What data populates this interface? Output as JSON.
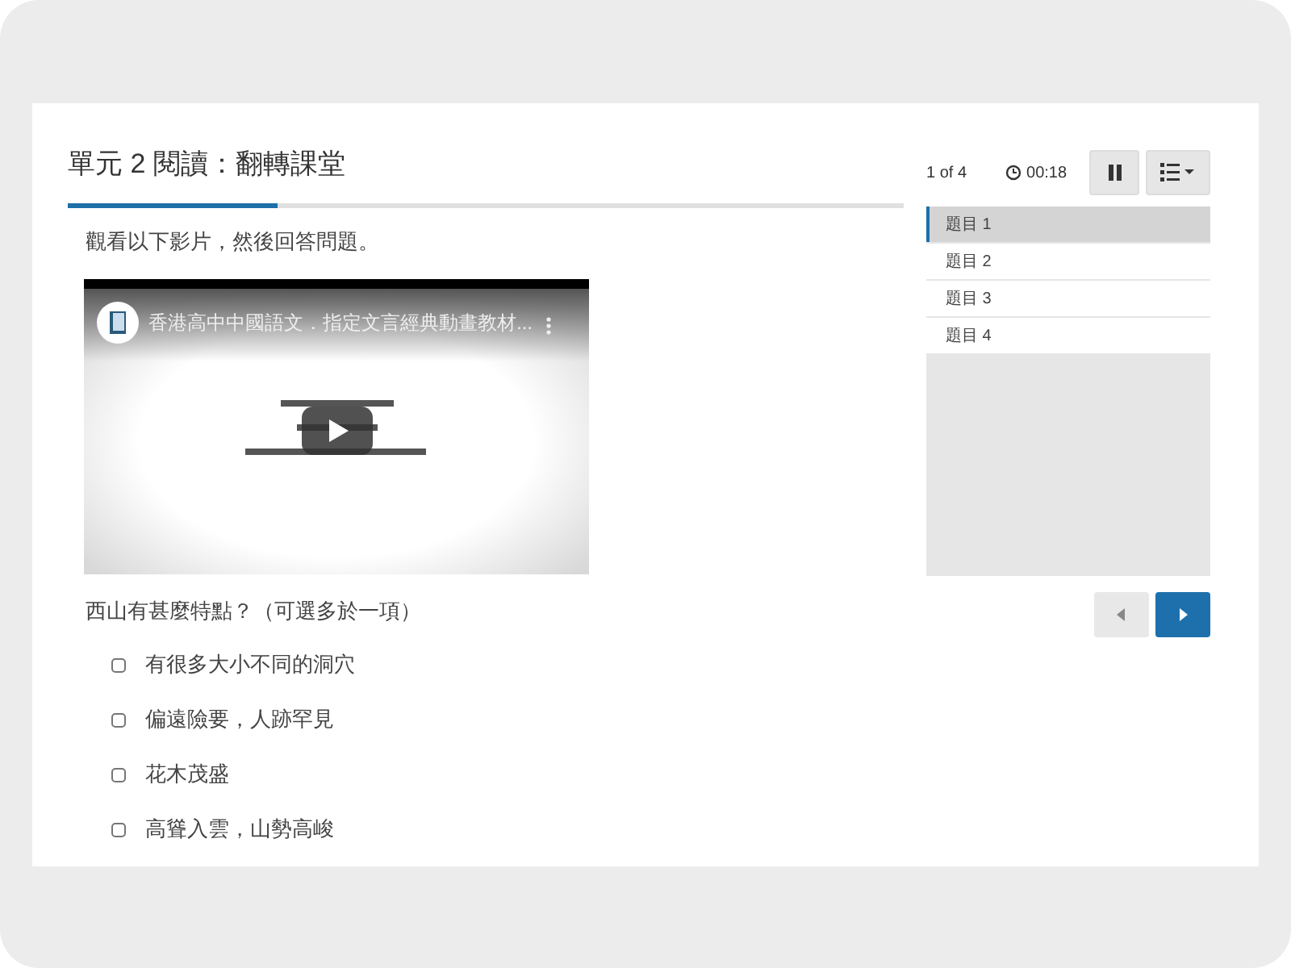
{
  "title": "單元 2 閱讀：翻轉課堂",
  "progress": {
    "level": 0.25
  },
  "instruction": "觀看以下影片，然後回答問題。",
  "video": {
    "title": "香港高中中國語文．指定文言經典動畫教材..."
  },
  "question": "西山有甚麼特點？（可選多於一項）",
  "options": [
    {
      "label": "有很多大小不同的洞穴",
      "checked": false
    },
    {
      "label": "偏遠險要，人跡罕見",
      "checked": false
    },
    {
      "label": "花木茂盛",
      "checked": false
    },
    {
      "label": "高聳入雲，山勢高峻",
      "checked": false
    }
  ],
  "counter": "1 of 4",
  "timer": "00:18",
  "questions": [
    {
      "label": "題目 1",
      "selected": true
    },
    {
      "label": "題目 2",
      "selected": false
    },
    {
      "label": "題目 3",
      "selected": false
    },
    {
      "label": "題目 4",
      "selected": false
    }
  ]
}
